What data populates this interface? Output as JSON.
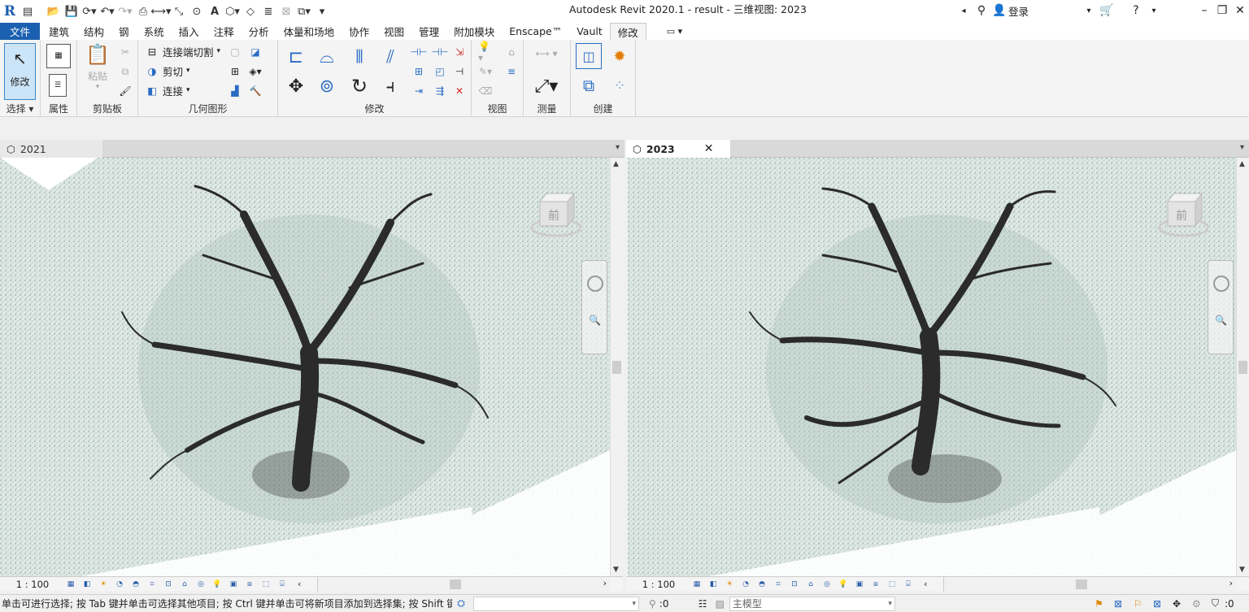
{
  "app": {
    "title": "Autodesk Revit 2020.1 - result - 三维视图: 2023",
    "login": "登录"
  },
  "menu_tabs": [
    "文件",
    "建筑",
    "结构",
    "钢",
    "系统",
    "插入",
    "注释",
    "分析",
    "体量和场地",
    "协作",
    "视图",
    "管理",
    "附加模块",
    "Enscape™",
    "Vault",
    "修改"
  ],
  "ribbon": {
    "select": {
      "button": "修改",
      "panel": "选择 ▾"
    },
    "properties": {
      "panel": "属性"
    },
    "clipboard": {
      "paste": "粘贴",
      "panel": "剪贴板"
    },
    "geometry": {
      "cope": "连接端切割",
      "cut": "剪切",
      "join": "连接",
      "panel": "几何图形"
    },
    "modify": {
      "panel": "修改"
    },
    "view": {
      "panel": "视图"
    },
    "measure": {
      "panel": "测量"
    },
    "create": {
      "panel": "创建"
    }
  },
  "views": [
    {
      "tab": "2021",
      "active": false,
      "scale": "1 : 100"
    },
    {
      "tab": "2023",
      "active": true,
      "scale": "1 : 100"
    }
  ],
  "viewcube_label": "前",
  "status": {
    "hint": "单击可进行选择; 按 Tab 键并单击可选择其他项目; 按 Ctrl 键并单击可将新项目添加到选择集; 按 Shift 键",
    "filter_count": ":0",
    "model": "主模型",
    "selection_count": ":0"
  },
  "colors": {
    "accent": "#1b5fb0",
    "canvas": "#e9efed",
    "foliage": "#8fb0a7",
    "trunk": "#2b2b2b"
  }
}
